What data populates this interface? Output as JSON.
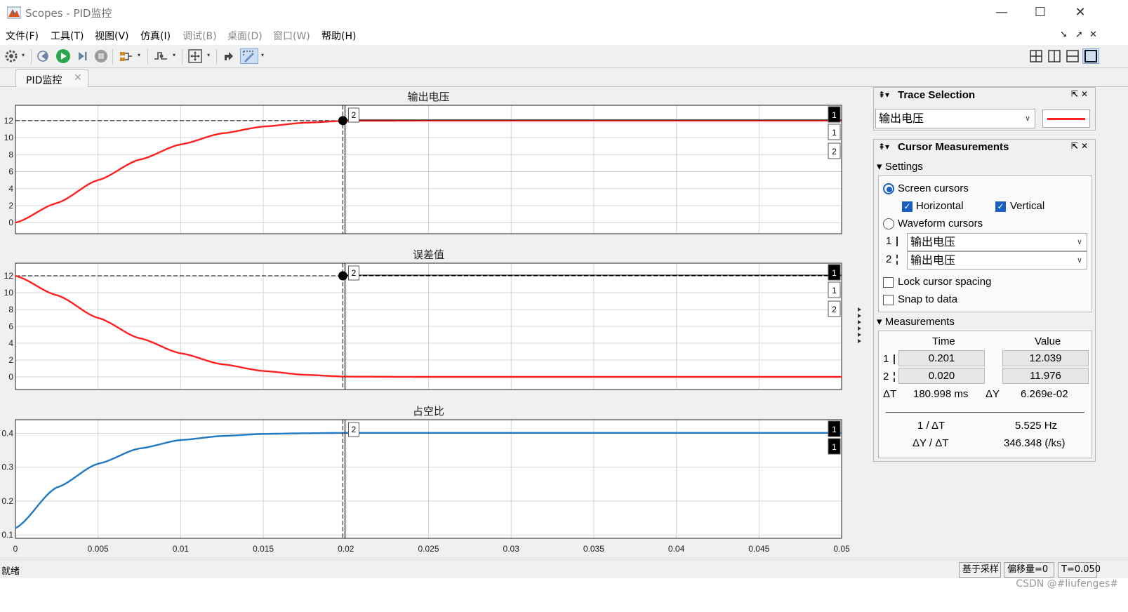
{
  "window": {
    "title": "Scopes - PID监控",
    "minimize_label": "—",
    "maximize_label": "☐",
    "close_label": "✕"
  },
  "menu": {
    "items": [
      "文件(F)",
      "工具(T)",
      "视图(V)",
      "仿真(I)",
      "调试(B)",
      "桌面(D)",
      "窗口(W)",
      "帮助(H)"
    ],
    "disabled": [
      "调试(B)",
      "桌面(D)",
      "窗口(W)"
    ],
    "right_arrows": [
      "➘",
      "➚",
      "✕"
    ]
  },
  "tab": {
    "label": "PID监控",
    "close": "✕"
  },
  "plots": [
    {
      "title": "输出电压",
      "ylim": [
        -1.3,
        13.8
      ],
      "yticks": [
        "12",
        "10",
        "8",
        "6",
        "4",
        "2",
        "0"
      ],
      "ytick_values": [
        12,
        10,
        8,
        6,
        4,
        2,
        0
      ],
      "color": "#ff1f1f",
      "cursor_y_level": 12,
      "markers": [
        "1",
        "1",
        "2"
      ],
      "cursor_label": "2"
    },
    {
      "title": "误差值",
      "ylim": [
        -1.5,
        13.5
      ],
      "yticks": [
        "12",
        "10",
        "8",
        "6",
        "4",
        "2",
        "0"
      ],
      "ytick_values": [
        12,
        10,
        8,
        6,
        4,
        2,
        0
      ],
      "color": "#ff1f1f",
      "cursor_y_level": 12,
      "markers": [
        "1",
        "1",
        "2"
      ],
      "cursor_label": "2"
    },
    {
      "title": "占空比",
      "ylim": [
        0.09,
        0.44
      ],
      "yticks": [
        "0.4",
        "0.3",
        "0.2",
        "0.1"
      ],
      "ytick_values": [
        0.4,
        0.3,
        0.2,
        0.1
      ],
      "color": "#1f78c2",
      "cursor_y_level": null,
      "markers": [
        "1",
        "1"
      ],
      "cursor_label": "2"
    }
  ],
  "chart_data": [
    {
      "type": "line",
      "title": "输出电压",
      "x": [
        0,
        0.0025,
        0.005,
        0.0075,
        0.01,
        0.0125,
        0.015,
        0.0175,
        0.02,
        0.025,
        0.03,
        0.035,
        0.04,
        0.045,
        0.05
      ],
      "series": [
        {
          "values": [
            0,
            2.3,
            5.0,
            7.4,
            9.2,
            10.5,
            11.3,
            11.75,
            11.97,
            12.0,
            12.0,
            12.0,
            12.0,
            12.0,
            12.0
          ]
        }
      ],
      "xlim": [
        0,
        0.05
      ],
      "ylim": [
        -1.3,
        13.8
      ],
      "grid": true
    },
    {
      "type": "line",
      "title": "误差值",
      "x": [
        0,
        0.0025,
        0.005,
        0.0075,
        0.01,
        0.0125,
        0.015,
        0.0175,
        0.02,
        0.025,
        0.03,
        0.035,
        0.04,
        0.045,
        0.05
      ],
      "series": [
        {
          "values": [
            12,
            9.7,
            7.0,
            4.6,
            2.8,
            1.5,
            0.7,
            0.25,
            0.03,
            0,
            0,
            0,
            0,
            0,
            0
          ]
        }
      ],
      "xlim": [
        0,
        0.05
      ],
      "ylim": [
        -1.5,
        13.5
      ],
      "grid": true
    },
    {
      "type": "line",
      "title": "占空比",
      "x": [
        0,
        0.0025,
        0.005,
        0.0075,
        0.01,
        0.0125,
        0.015,
        0.0175,
        0.02,
        0.025,
        0.03,
        0.035,
        0.04,
        0.045,
        0.05
      ],
      "series": [
        {
          "values": [
            0.12,
            0.24,
            0.31,
            0.355,
            0.38,
            0.392,
            0.398,
            0.4,
            0.401,
            0.401,
            0.401,
            0.401,
            0.401,
            0.401,
            0.401
          ]
        }
      ],
      "xlim": [
        0,
        0.05
      ],
      "ylim": [
        0.09,
        0.44
      ],
      "grid": true
    }
  ],
  "xaxis": {
    "ticks": [
      "0",
      "0.005",
      "0.01",
      "0.015",
      "0.02",
      "0.025",
      "0.03",
      "0.035",
      "0.04",
      "0.045",
      "0.05"
    ],
    "tick_values": [
      0,
      0.005,
      0.01,
      0.015,
      0.02,
      0.025,
      0.03,
      0.035,
      0.04,
      0.045,
      0.05
    ],
    "xlim": [
      0,
      0.05
    ],
    "cursor_x": 0.0199
  },
  "trace_selection": {
    "title": "Trace Selection",
    "pin": "⇞▾",
    "buttons": "⇱✕",
    "selected": "输出电压",
    "line_color": "#ff1f1f"
  },
  "cursor_measurements": {
    "title": "Cursor Measurements",
    "pin": "⇞▾",
    "buttons": "⇱✕",
    "settings_label": "▾ Settings",
    "screen_cursors": "Screen cursors",
    "horizontal": "Horizontal",
    "vertical": "Vertical",
    "waveform_cursors": "Waveform cursors",
    "wf1_index": "1",
    "wf2_index": "2",
    "wf1_signal": "输出电压",
    "wf2_signal": "输出电压",
    "lock_spacing": "Lock cursor spacing",
    "snap_to_data": "Snap to data",
    "measurements_label": "▾ Measurements",
    "col_time": "Time",
    "col_value": "Value",
    "row1_index": "1",
    "row2_index": "2",
    "row1_time": "0.201",
    "row1_value": "12.039",
    "row2_time": "0.020",
    "row2_value": "11.976",
    "dt_label": "ΔT",
    "dt_value": "180.998 ms",
    "dy_label": "ΔY",
    "dy_value": "6.269e-02",
    "inv_dt_label": "1 / ΔT",
    "inv_dt_value": "5.525 Hz",
    "dydt_label": "ΔY / ΔT",
    "dydt_value": "346.348 (/ks)"
  },
  "status": {
    "left": "就绪",
    "sample_based": "基于采样",
    "offset": "偏移量=0",
    "time": "T=0.050"
  },
  "watermark": "CSDN @#liufenges#"
}
